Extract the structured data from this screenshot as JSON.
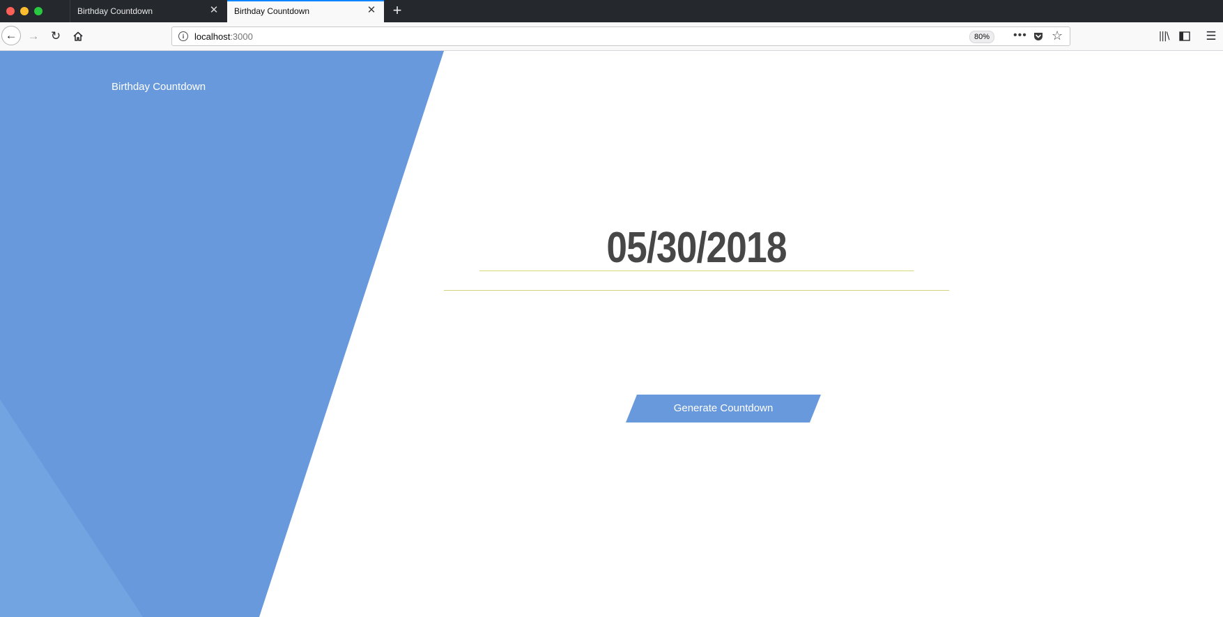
{
  "browser": {
    "tabs": [
      {
        "title": "Birthday Countdown",
        "active": false
      },
      {
        "title": "Birthday Countdown",
        "active": true
      }
    ],
    "url_host": "localhost",
    "url_port": ":3000",
    "zoom": "80%",
    "icons": {
      "back": "arrow-left-icon",
      "forward": "arrow-right-icon",
      "reload": "reload-icon",
      "home": "home-icon",
      "info": "info-icon",
      "more": "more-icon",
      "pocket": "pocket-icon",
      "bookmark": "star-icon",
      "library": "library-icon",
      "sidebar": "sidebar-icon",
      "menu": "hamburger-menu-icon"
    }
  },
  "app": {
    "brand": "Birthday Countdown",
    "date_value": "05/30/2018",
    "generate_button": "Generate Countdown"
  },
  "colors": {
    "accent_blue": "#6899dc",
    "accent_blue_light": "#72a4e2",
    "input_underline": "#d2d27a",
    "date_text": "#474747"
  }
}
